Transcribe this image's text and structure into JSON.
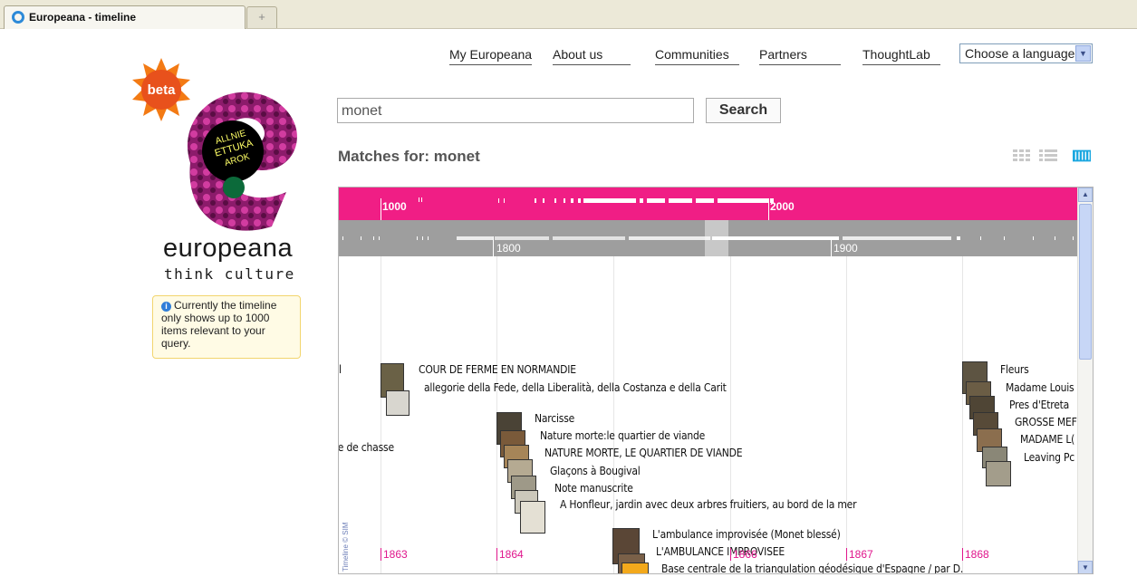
{
  "browser": {
    "tab_title": "Europeana - timeline",
    "new_tab_symbol": "+"
  },
  "nav": {
    "items": [
      "My Europeana",
      "About us",
      "Communities",
      "Partners",
      "ThoughtLab"
    ],
    "language_select": "Choose a language"
  },
  "logo": {
    "badge": "beta",
    "wordmark": "europeana",
    "tagline": "think culture"
  },
  "note": {
    "text": "Currently the timeline only shows up to 1000 items relevant to your query."
  },
  "search": {
    "value": "monet",
    "button": "Search"
  },
  "results": {
    "heading": "Matches for: monet",
    "view_icons": [
      "grid-view-icon",
      "list-view-icon",
      "timeline-view-icon"
    ]
  },
  "timeline": {
    "overview_labels": [
      "1000",
      "2000"
    ],
    "decade_labels": [
      "1800",
      "1900"
    ],
    "year_labels": [
      "1863",
      "1864",
      "1866",
      "1867",
      "1868"
    ],
    "credit": "Timeline © SIMILE",
    "events": [
      "l",
      "COUR DE FERME EN NORMANDIE",
      "allegorie della Fede, della Liberalità, della Costanza e della Carit",
      "Fleurs",
      "Madame Louis",
      "Pres d'Etreta",
      "GROSSE MEF",
      "MADAME L(",
      "Leaving Pc",
      "Narcisse",
      "Nature morte:le quartier de viande",
      "NATURE MORTE, LE QUARTIER DE VIANDE",
      "Glaçons à Bougival",
      "Note manuscrite",
      "A Honfleur, jardin avec deux arbres fruitiers, au bord de la mer",
      "ie de chasse",
      "L'ambulance improvisée (Monet blessé)",
      "L'AMBULANCE IMPROVISEE",
      "Base centrale de la triangulation géodésique d'Espagne / par D."
    ]
  },
  "colors": {
    "timeline_pink": "#f01e85",
    "timeline_gray": "#9e9e9e",
    "note_bg": "#fffbe5",
    "date_pink": "#e0168c"
  }
}
